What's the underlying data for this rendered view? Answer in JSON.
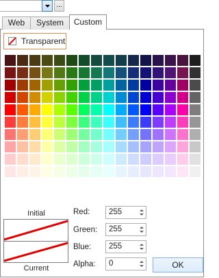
{
  "toolbar": {
    "ellipsis_label": "..."
  },
  "tabs": [
    {
      "label": "Web"
    },
    {
      "label": "System"
    },
    {
      "label": "Custom",
      "active": true
    }
  ],
  "transparent_button": {
    "label": "Transparent"
  },
  "palette": {
    "rows": [
      [
        "#4b1414",
        "#4b2a14",
        "#4b3c14",
        "#4b4b14",
        "#3c4b14",
        "#1e4b14",
        "#144b28",
        "#144b3c",
        "#144b4b",
        "#143c4b",
        "#14284b",
        "#14144b",
        "#28144b",
        "#3c144b",
        "#4b143c",
        "#1e1e1e"
      ],
      [
        "#781414",
        "#782d14",
        "#785014",
        "#787814",
        "#507814",
        "#287814",
        "#147832",
        "#147850",
        "#147878",
        "#145078",
        "#142d78",
        "#141478",
        "#321478",
        "#501478",
        "#781450",
        "#323232"
      ],
      [
        "#a00000",
        "#a03c00",
        "#a06400",
        "#a0a000",
        "#64a000",
        "#32a000",
        "#00a03c",
        "#00a064",
        "#00a0a0",
        "#0064a0",
        "#003ca0",
        "#0000a0",
        "#3c00a0",
        "#6400a0",
        "#a00064",
        "#4b4b4b"
      ],
      [
        "#d20000",
        "#d24600",
        "#d28c00",
        "#d2d200",
        "#8cd200",
        "#46d200",
        "#00d246",
        "#00d28c",
        "#00d2d2",
        "#008cd2",
        "#0046d2",
        "#0000d2",
        "#4600d2",
        "#8c00d2",
        "#d2008c",
        "#646464"
      ],
      [
        "#ff0000",
        "#ff5a00",
        "#ffaa00",
        "#ffff00",
        "#aaff00",
        "#5aff00",
        "#00ff5a",
        "#00ffaa",
        "#00ffff",
        "#00aaff",
        "#005aff",
        "#0000ff",
        "#5a00ff",
        "#aa00ff",
        "#ff00aa",
        "#7d7d7d"
      ],
      [
        "#ff3c3c",
        "#ff7d3c",
        "#ffbe3c",
        "#ffff3c",
        "#beff3c",
        "#7dff3c",
        "#3cff7d",
        "#3cffbe",
        "#3cffff",
        "#3cbeff",
        "#3c7dff",
        "#3c3cff",
        "#7d3cff",
        "#be3cff",
        "#ff3cbe",
        "#969696"
      ],
      [
        "#ff7373",
        "#ff9f73",
        "#ffcd73",
        "#ffff73",
        "#cdff73",
        "#9fff73",
        "#73ff9f",
        "#73ffcd",
        "#73ffff",
        "#73cdff",
        "#739fff",
        "#7373ff",
        "#9f73ff",
        "#cd73ff",
        "#ff73cd",
        "#afafaf"
      ],
      [
        "#ffa5a5",
        "#ffc0a5",
        "#ffdca5",
        "#ffffa5",
        "#dcffa5",
        "#c0ffa5",
        "#a5ffc0",
        "#a5ffdc",
        "#a5ffff",
        "#a5dcff",
        "#a5c0ff",
        "#a5a5ff",
        "#c0a5ff",
        "#dca5ff",
        "#ffa5dc",
        "#c8c8c8"
      ],
      [
        "#ffcdcd",
        "#ffdccd",
        "#ffeacd",
        "#ffffcd",
        "#eaffcd",
        "#dcffcd",
        "#cdffdc",
        "#cdffea",
        "#cdffff",
        "#cdeaff",
        "#cddcff",
        "#cdcdff",
        "#dccdff",
        "#eacdff",
        "#ffcdea",
        "#e1e1e1"
      ],
      [
        "#ffe6e6",
        "#ffede6",
        "#fff4e6",
        "#ffffe6",
        "#f4ffe6",
        "#edffe6",
        "#e6ffed",
        "#e6fff4",
        "#e6ffff",
        "#e6f4ff",
        "#e6edff",
        "#e6e6ff",
        "#ede6ff",
        "#f4e6ff",
        "#ffe6f4",
        "#f0f0f0"
      ]
    ]
  },
  "preview": {
    "initial_label": "Initial",
    "current_label": "Current",
    "slash_color": "#e00000"
  },
  "fields": {
    "red": {
      "label": "Red:",
      "value": "255"
    },
    "green": {
      "label": "Green:",
      "value": "255"
    },
    "blue": {
      "label": "Blue:",
      "value": "255"
    },
    "alpha": {
      "label": "Alpha:",
      "value": "0"
    }
  },
  "ok_button": {
    "label": "OK"
  },
  "colors": {
    "focus_border": "#e9894d",
    "ok_border": "#7eb4ea"
  }
}
